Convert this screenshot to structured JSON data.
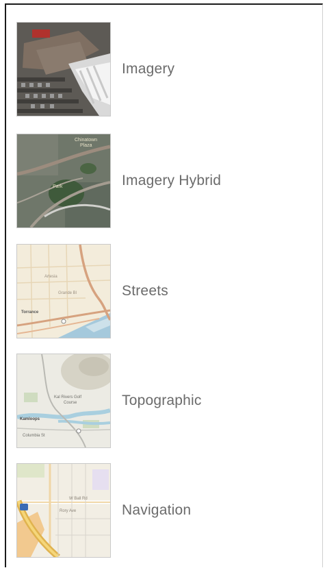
{
  "basemaps": [
    {
      "label": "Imagery",
      "icon": "imagery-thumbnail"
    },
    {
      "label": "Imagery Hybrid",
      "icon": "imagery-hybrid-thumbnail"
    },
    {
      "label": "Streets",
      "icon": "streets-thumbnail"
    },
    {
      "label": "Topographic",
      "icon": "topographic-thumbnail"
    },
    {
      "label": "Navigation",
      "icon": "navigation-thumbnail"
    }
  ],
  "colors": {
    "label_text": "#6b6b6b",
    "panel_border": "#1a1a1a",
    "thumb_border": "#c9c9c9"
  }
}
